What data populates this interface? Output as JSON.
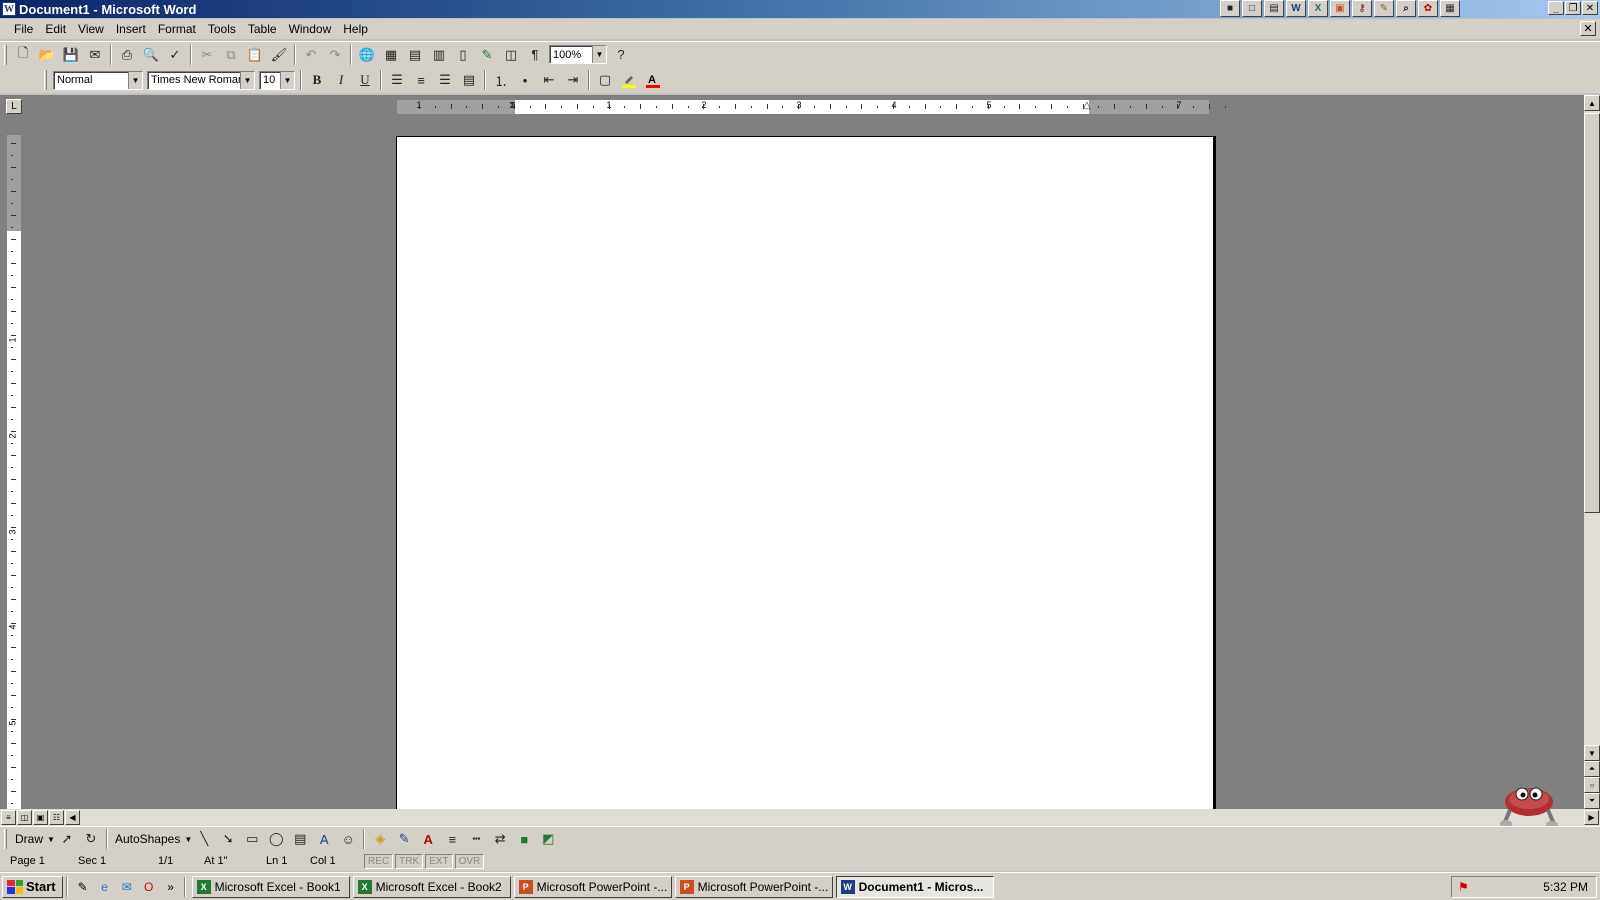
{
  "window": {
    "title": "Document1 - Microsoft Word"
  },
  "office_bar": {
    "icons": [
      "office-icon",
      "new-office-doc-icon",
      "word-icon",
      "excel-icon",
      "powerpoint-icon",
      "access-icon",
      "tools-icon",
      "search-icon",
      "outlook-icon",
      "accessories-icon"
    ]
  },
  "menu": {
    "items": [
      "File",
      "Edit",
      "View",
      "Insert",
      "Format",
      "Tools",
      "Table",
      "Window",
      "Help"
    ]
  },
  "standard_toolbar": {
    "zoom": "100%"
  },
  "formatting_toolbar": {
    "style": "Normal",
    "font": "Times New Roman",
    "size": "10",
    "bold": "B",
    "italic": "I",
    "underline": "U",
    "highlight_color": "#ffff00",
    "font_color": "#ff0000"
  },
  "ruler": {
    "marks": [
      "1",
      "1",
      "2",
      "3",
      "4",
      "5",
      "7"
    ],
    "vertical_marks": [
      "1",
      "2",
      "3",
      "4",
      "5"
    ]
  },
  "drawing_toolbar": {
    "draw": "Draw",
    "autoshapes": "AutoShapes"
  },
  "status": {
    "page": "Page 1",
    "section": "Sec 1",
    "pages": "1/1",
    "at": "At 1\"",
    "line": "Ln 1",
    "col": "Col 1",
    "rec": "REC",
    "trk": "TRK",
    "ext": "EXT",
    "ovr": "OVR"
  },
  "taskbar": {
    "start": "Start",
    "tasks": [
      {
        "label": "Microsoft Excel - Book1",
        "icon": "excel-icon",
        "color": "#1e7b34"
      },
      {
        "label": "Microsoft Excel - Book2",
        "icon": "excel-icon",
        "color": "#1e7b34"
      },
      {
        "label": "Microsoft PowerPoint -...",
        "icon": "powerpoint-icon",
        "color": "#c8501e"
      },
      {
        "label": "Microsoft PowerPoint -...",
        "icon": "powerpoint-icon",
        "color": "#c8501e"
      },
      {
        "label": "Document1 - Micros...",
        "icon": "word-icon",
        "color": "#1f3c88"
      }
    ],
    "clock": "5:32 PM"
  }
}
